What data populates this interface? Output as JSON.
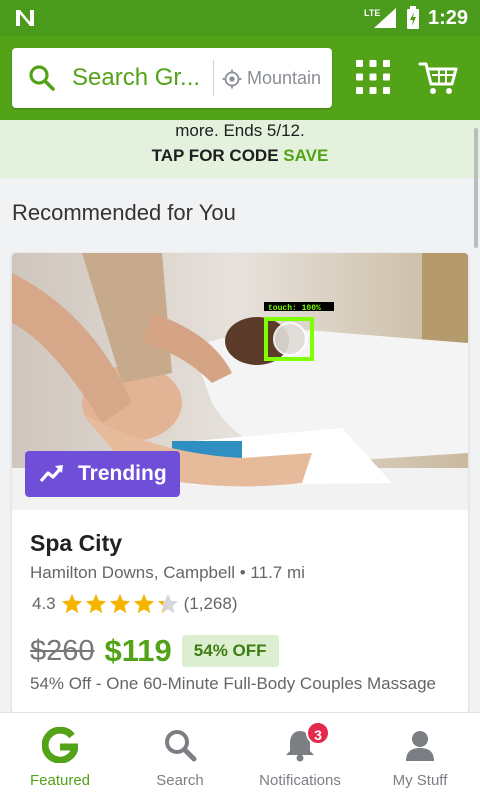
{
  "status_bar": {
    "network": "LTE",
    "time": "1:29"
  },
  "search": {
    "placeholder": "Search Gr...",
    "location": "Mountain"
  },
  "promo": {
    "line1": "more. Ends 5/12.",
    "tap_label": "TAP FOR CODE",
    "save_label": "SAVE"
  },
  "section": {
    "title": "Recommended for You"
  },
  "deal": {
    "badge": "Trending",
    "touch_overlay": "touch: 100%",
    "title": "Spa City",
    "location": "Hamilton Downs, Campbell • 11.7 mi",
    "rating_value": "4.3",
    "rating_stars": 4.3,
    "rating_count": "(1,268)",
    "original_price": "$260",
    "price": "$119",
    "discount": "54% OFF",
    "description": "54% Off - One 60-Minute Full-Body Couples Massage"
  },
  "nav": {
    "featured": "Featured",
    "search": "Search",
    "notifications": "Notifications",
    "notifications_count": "3",
    "my_stuff": "My Stuff"
  },
  "colors": {
    "brand_green": "#53a318",
    "trending_purple": "#6f4ed8",
    "star": "#f7b500",
    "badge_red": "#e5294a"
  }
}
